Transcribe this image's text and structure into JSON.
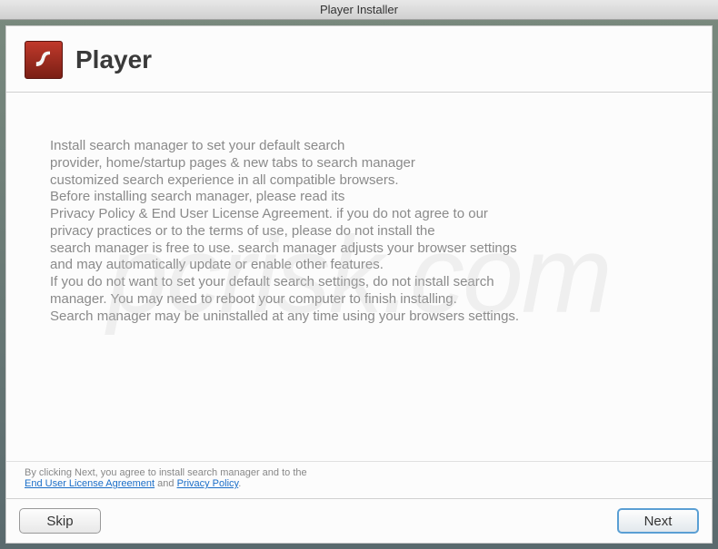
{
  "titlebar": {
    "title": "Player Installer"
  },
  "header": {
    "title": "Player"
  },
  "content": {
    "line1": "Install search manager to set your default search",
    "line2": "provider, home/startup pages & new tabs to search manager",
    "line3": "customized search experience in all compatible browsers.",
    "line4": "Before installing search manager, please read its",
    "line5": "Privacy Policy & End User License Agreement. if you do not agree to our",
    "line6": "privacy practices or to the terms of use, please do not install the",
    "line7": "search manager is free to use. search manager adjusts your browser settings",
    "line8": "and may automatically update or enable other features.",
    "line9": "If you do not want to set your default search settings, do not install search",
    "line10": "manager. You may need to reboot your computer to finish installing.",
    "line11": "Search manager may be uninstalled at any time using your browsers settings."
  },
  "footer": {
    "prefix": "By clicking Next, you agree to install search manager and to the",
    "eula": "End User License Agreement",
    "and": " and ",
    "privacy": "Privacy Policy",
    "period": "."
  },
  "buttons": {
    "skip": "Skip",
    "next": "Next"
  },
  "watermark": "pcrisk.com"
}
